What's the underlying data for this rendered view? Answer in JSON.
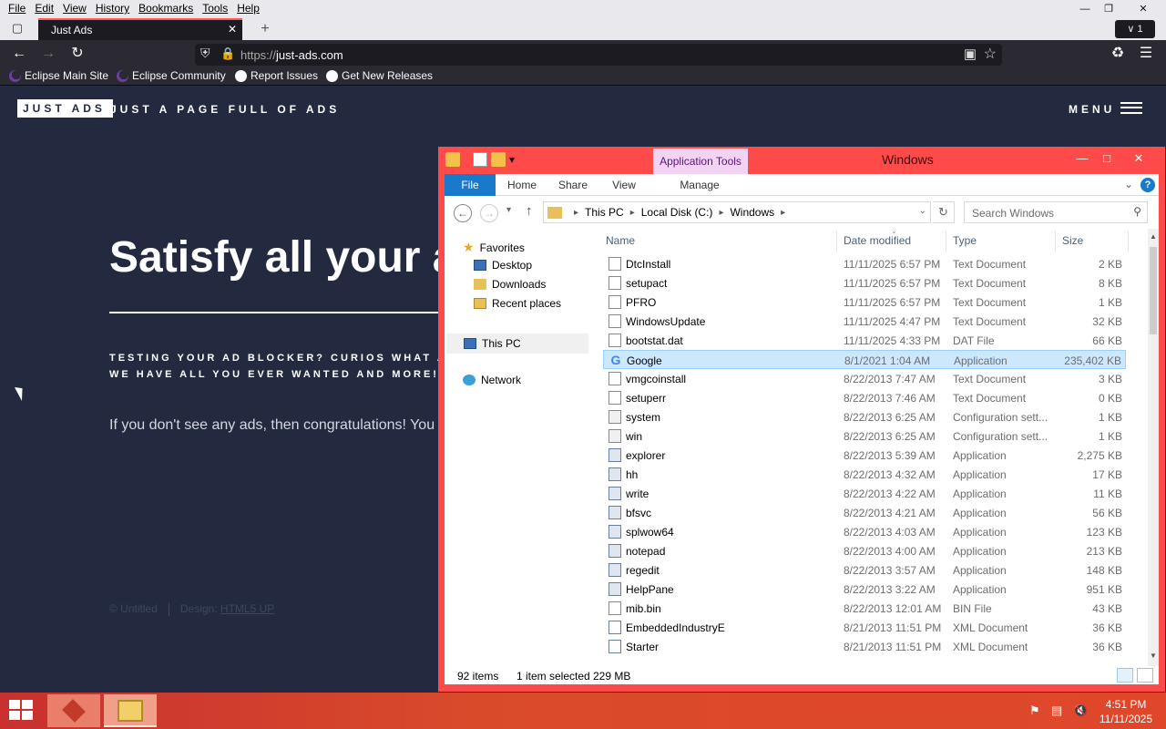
{
  "browser": {
    "menu": [
      "File",
      "Edit",
      "View",
      "History",
      "Bookmarks",
      "Tools",
      "Help"
    ],
    "tab_title": "Just Ads",
    "url_scheme": "https://",
    "url_host": "just-ads.com",
    "tabs_count": "1",
    "bookmarks": [
      "Eclipse Main Site",
      "Eclipse Community",
      "Report Issues",
      "Get New Releases"
    ]
  },
  "page": {
    "logo": "JUST ADS",
    "logo_subtitle": "JUST A PAGE FULL OF ADS",
    "menu_label": "MENU",
    "hero": "Satisfy all your a",
    "sub_line1": "TESTING YOUR AD BLOCKER? CURIOS WHAT ADVER",
    "sub_line2": "WE HAVE ALL YOU EVER WANTED AND MORE!",
    "paragraph": "If you don't see any ads, then congratulations! You ha",
    "footer_copyright": "© Untitled",
    "footer_design_prefix": "Design: ",
    "footer_design_link": "HTML5 UP"
  },
  "explorer": {
    "window_title": "Windows",
    "context_tab_group": "Application Tools",
    "ribbon_tabs": [
      "File",
      "Home",
      "Share",
      "View",
      "Manage"
    ],
    "breadcrumb": [
      "This PC",
      "Local Disk (C:)",
      "Windows"
    ],
    "search_placeholder": "Search Windows",
    "nav": {
      "favorites": "Favorites",
      "desktop": "Desktop",
      "downloads": "Downloads",
      "recent": "Recent places",
      "this_pc": "This PC",
      "network": "Network"
    },
    "columns": [
      "Name",
      "Date modified",
      "Type",
      "Size"
    ],
    "files": [
      {
        "name": "DtcInstall",
        "date": "11/11/2025 6:57 PM",
        "type": "Text Document",
        "size": "2 KB",
        "icon": "txt"
      },
      {
        "name": "setupact",
        "date": "11/11/2025 6:57 PM",
        "type": "Text Document",
        "size": "8 KB",
        "icon": "txt"
      },
      {
        "name": "PFRO",
        "date": "11/11/2025 6:57 PM",
        "type": "Text Document",
        "size": "1 KB",
        "icon": "txt"
      },
      {
        "name": "WindowsUpdate",
        "date": "11/11/2025 4:47 PM",
        "type": "Text Document",
        "size": "32 KB",
        "icon": "txt"
      },
      {
        "name": "bootstat.dat",
        "date": "11/11/2025 4:33 PM",
        "type": "DAT File",
        "size": "66 KB",
        "icon": "txt"
      },
      {
        "name": "Google",
        "date": "8/1/2021 1:04 AM",
        "type": "Application",
        "size": "235,402 KB",
        "icon": "google"
      },
      {
        "name": "vmgcoinstall",
        "date": "8/22/2013 7:47 AM",
        "type": "Text Document",
        "size": "3 KB",
        "icon": "txt"
      },
      {
        "name": "setuperr",
        "date": "8/22/2013 7:46 AM",
        "type": "Text Document",
        "size": "0 KB",
        "icon": "txt"
      },
      {
        "name": "system",
        "date": "8/22/2013 6:25 AM",
        "type": "Configuration sett...",
        "size": "1 KB",
        "icon": "cfg"
      },
      {
        "name": "win",
        "date": "8/22/2013 6:25 AM",
        "type": "Configuration sett...",
        "size": "1 KB",
        "icon": "cfg"
      },
      {
        "name": "explorer",
        "date": "8/22/2013 5:39 AM",
        "type": "Application",
        "size": "2,275 KB",
        "icon": "app"
      },
      {
        "name": "hh",
        "date": "8/22/2013 4:32 AM",
        "type": "Application",
        "size": "17 KB",
        "icon": "app"
      },
      {
        "name": "write",
        "date": "8/22/2013 4:22 AM",
        "type": "Application",
        "size": "11 KB",
        "icon": "app"
      },
      {
        "name": "bfsvc",
        "date": "8/22/2013 4:21 AM",
        "type": "Application",
        "size": "56 KB",
        "icon": "app"
      },
      {
        "name": "splwow64",
        "date": "8/22/2013 4:03 AM",
        "type": "Application",
        "size": "123 KB",
        "icon": "app"
      },
      {
        "name": "notepad",
        "date": "8/22/2013 4:00 AM",
        "type": "Application",
        "size": "213 KB",
        "icon": "app"
      },
      {
        "name": "regedit",
        "date": "8/22/2013 3:57 AM",
        "type": "Application",
        "size": "148 KB",
        "icon": "app"
      },
      {
        "name": "HelpPane",
        "date": "8/22/2013 3:22 AM",
        "type": "Application",
        "size": "951 KB",
        "icon": "app"
      },
      {
        "name": "mib.bin",
        "date": "8/22/2013 12:01 AM",
        "type": "BIN File",
        "size": "43 KB",
        "icon": "txt"
      },
      {
        "name": "EmbeddedIndustryE",
        "date": "8/21/2013 11:51 PM",
        "type": "XML Document",
        "size": "36 KB",
        "icon": "xml"
      },
      {
        "name": "Starter",
        "date": "8/21/2013 11:51 PM",
        "type": "XML Document",
        "size": "36 KB",
        "icon": "xml"
      }
    ],
    "selected_file": "Google",
    "status_items": "92 items",
    "status_selected": "1 item selected",
    "status_size": "229 MB"
  },
  "taskbar": {
    "time": "4:51 PM",
    "date": "11/11/2025"
  }
}
